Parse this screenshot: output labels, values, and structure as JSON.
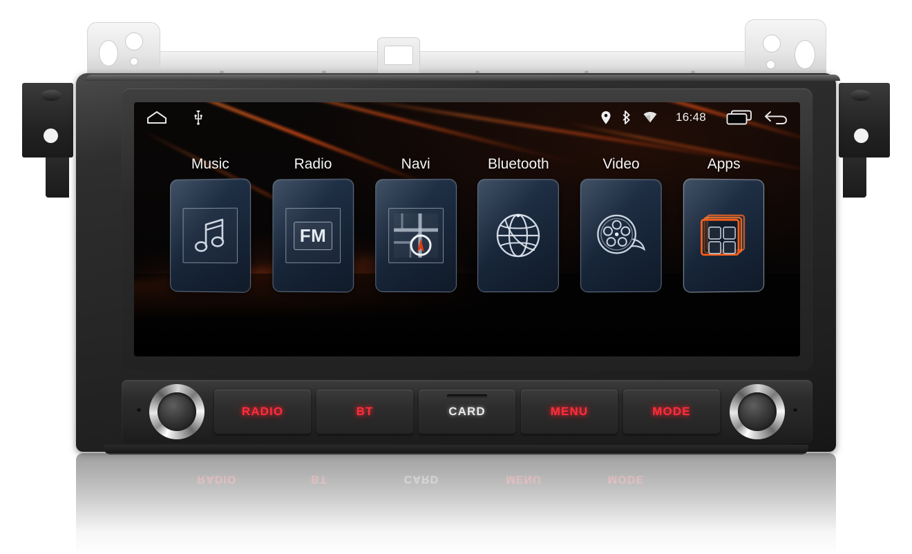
{
  "device": {
    "name": "android-car-head-unit",
    "bracket": {
      "name": "mounting-bracket",
      "center_tab": "card-slot-cutout"
    }
  },
  "screen": {
    "status_bar": {
      "left_icons": [
        {
          "name": "home-icon",
          "glyph": "home"
        },
        {
          "name": "usb-icon",
          "glyph": "usb"
        }
      ],
      "right_icons": [
        {
          "name": "location-pin-icon",
          "glyph": "location"
        },
        {
          "name": "bluetooth-icon",
          "glyph": "bluetooth"
        },
        {
          "name": "wifi-icon",
          "glyph": "wifi"
        }
      ],
      "time": "16:48",
      "nav_icons": [
        {
          "name": "recent-apps-icon",
          "glyph": "recents"
        },
        {
          "name": "back-icon",
          "glyph": "back"
        }
      ]
    },
    "apps": [
      {
        "id": "music",
        "label": "Music",
        "icon": "music-note-icon",
        "selected": false
      },
      {
        "id": "radio",
        "label": "Radio",
        "icon": "fm-radio-icon",
        "selected": false,
        "icon_text": "FM"
      },
      {
        "id": "navi",
        "label": "Navi",
        "icon": "navigation-map-icon",
        "selected": false
      },
      {
        "id": "bluetooth",
        "label": "Bluetooth",
        "icon": "bluetooth-globe-icon",
        "selected": false
      },
      {
        "id": "video",
        "label": "Video",
        "icon": "film-reel-icon",
        "selected": false
      },
      {
        "id": "apps",
        "label": "Apps",
        "icon": "app-grid-icon",
        "selected": true
      }
    ],
    "wallpaper": {
      "name": "orange-light-streaks-wallpaper",
      "background_color": "#050505",
      "accent_color": "#ff6a1e"
    }
  },
  "controls": {
    "left_knob": {
      "name": "volume-power-knob",
      "label": ""
    },
    "right_knob": {
      "name": "tune-select-knob",
      "label": ""
    },
    "buttons": [
      {
        "id": "radio",
        "label": "RADIO",
        "color": "#ff2d3c",
        "style": "red"
      },
      {
        "id": "bt",
        "label": "BT",
        "color": "#ff2d3c",
        "style": "red"
      },
      {
        "id": "card",
        "label": "CARD",
        "color": "#e9e9e9",
        "style": "white",
        "has_slot": true
      },
      {
        "id": "menu",
        "label": "MENU",
        "color": "#ff2d3c",
        "style": "red"
      },
      {
        "id": "mode",
        "label": "MODE",
        "color": "#ff2d3c",
        "style": "red"
      }
    ]
  }
}
